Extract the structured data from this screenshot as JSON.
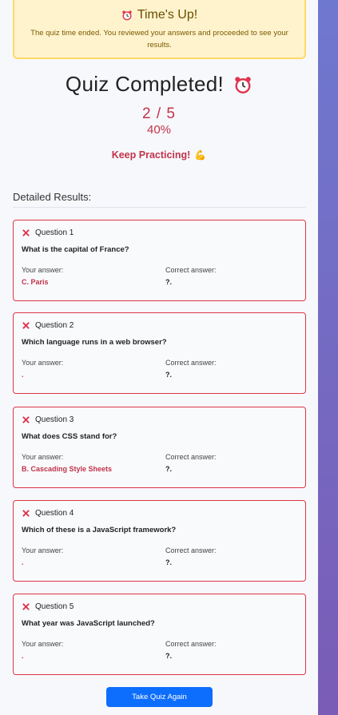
{
  "timeup": {
    "title": "Time's Up!",
    "text": "The quiz time ended. You reviewed your answers and proceeded to see your results."
  },
  "title": "Quiz Completed!",
  "score": "2 / 5",
  "percent": "40%",
  "message": "Keep Practicing!",
  "detail_title": "Detailed Results:",
  "labels": {
    "your": "Your answer:",
    "correct": "Correct answer:"
  },
  "questions": [
    {
      "label": "Question 1",
      "text": "What is the capital of France?",
      "your": "C. Paris",
      "correct": "?."
    },
    {
      "label": "Question 2",
      "text": "Which language runs in a web browser?",
      "your": ".",
      "correct": "?."
    },
    {
      "label": "Question 3",
      "text": "What does CSS stand for?",
      "your": "B. Cascading Style Sheets",
      "correct": "?."
    },
    {
      "label": "Question 4",
      "text": "Which of these is a JavaScript framework?",
      "your": ".",
      "correct": "?."
    },
    {
      "label": "Question 5",
      "text": "What year was JavaScript launched?",
      "your": ".",
      "correct": "?."
    }
  ],
  "button": "Take Quiz Again",
  "colors": {
    "danger": "#dc3545",
    "accent": "#0d6efd",
    "warning_bg": "#fff3cd"
  }
}
